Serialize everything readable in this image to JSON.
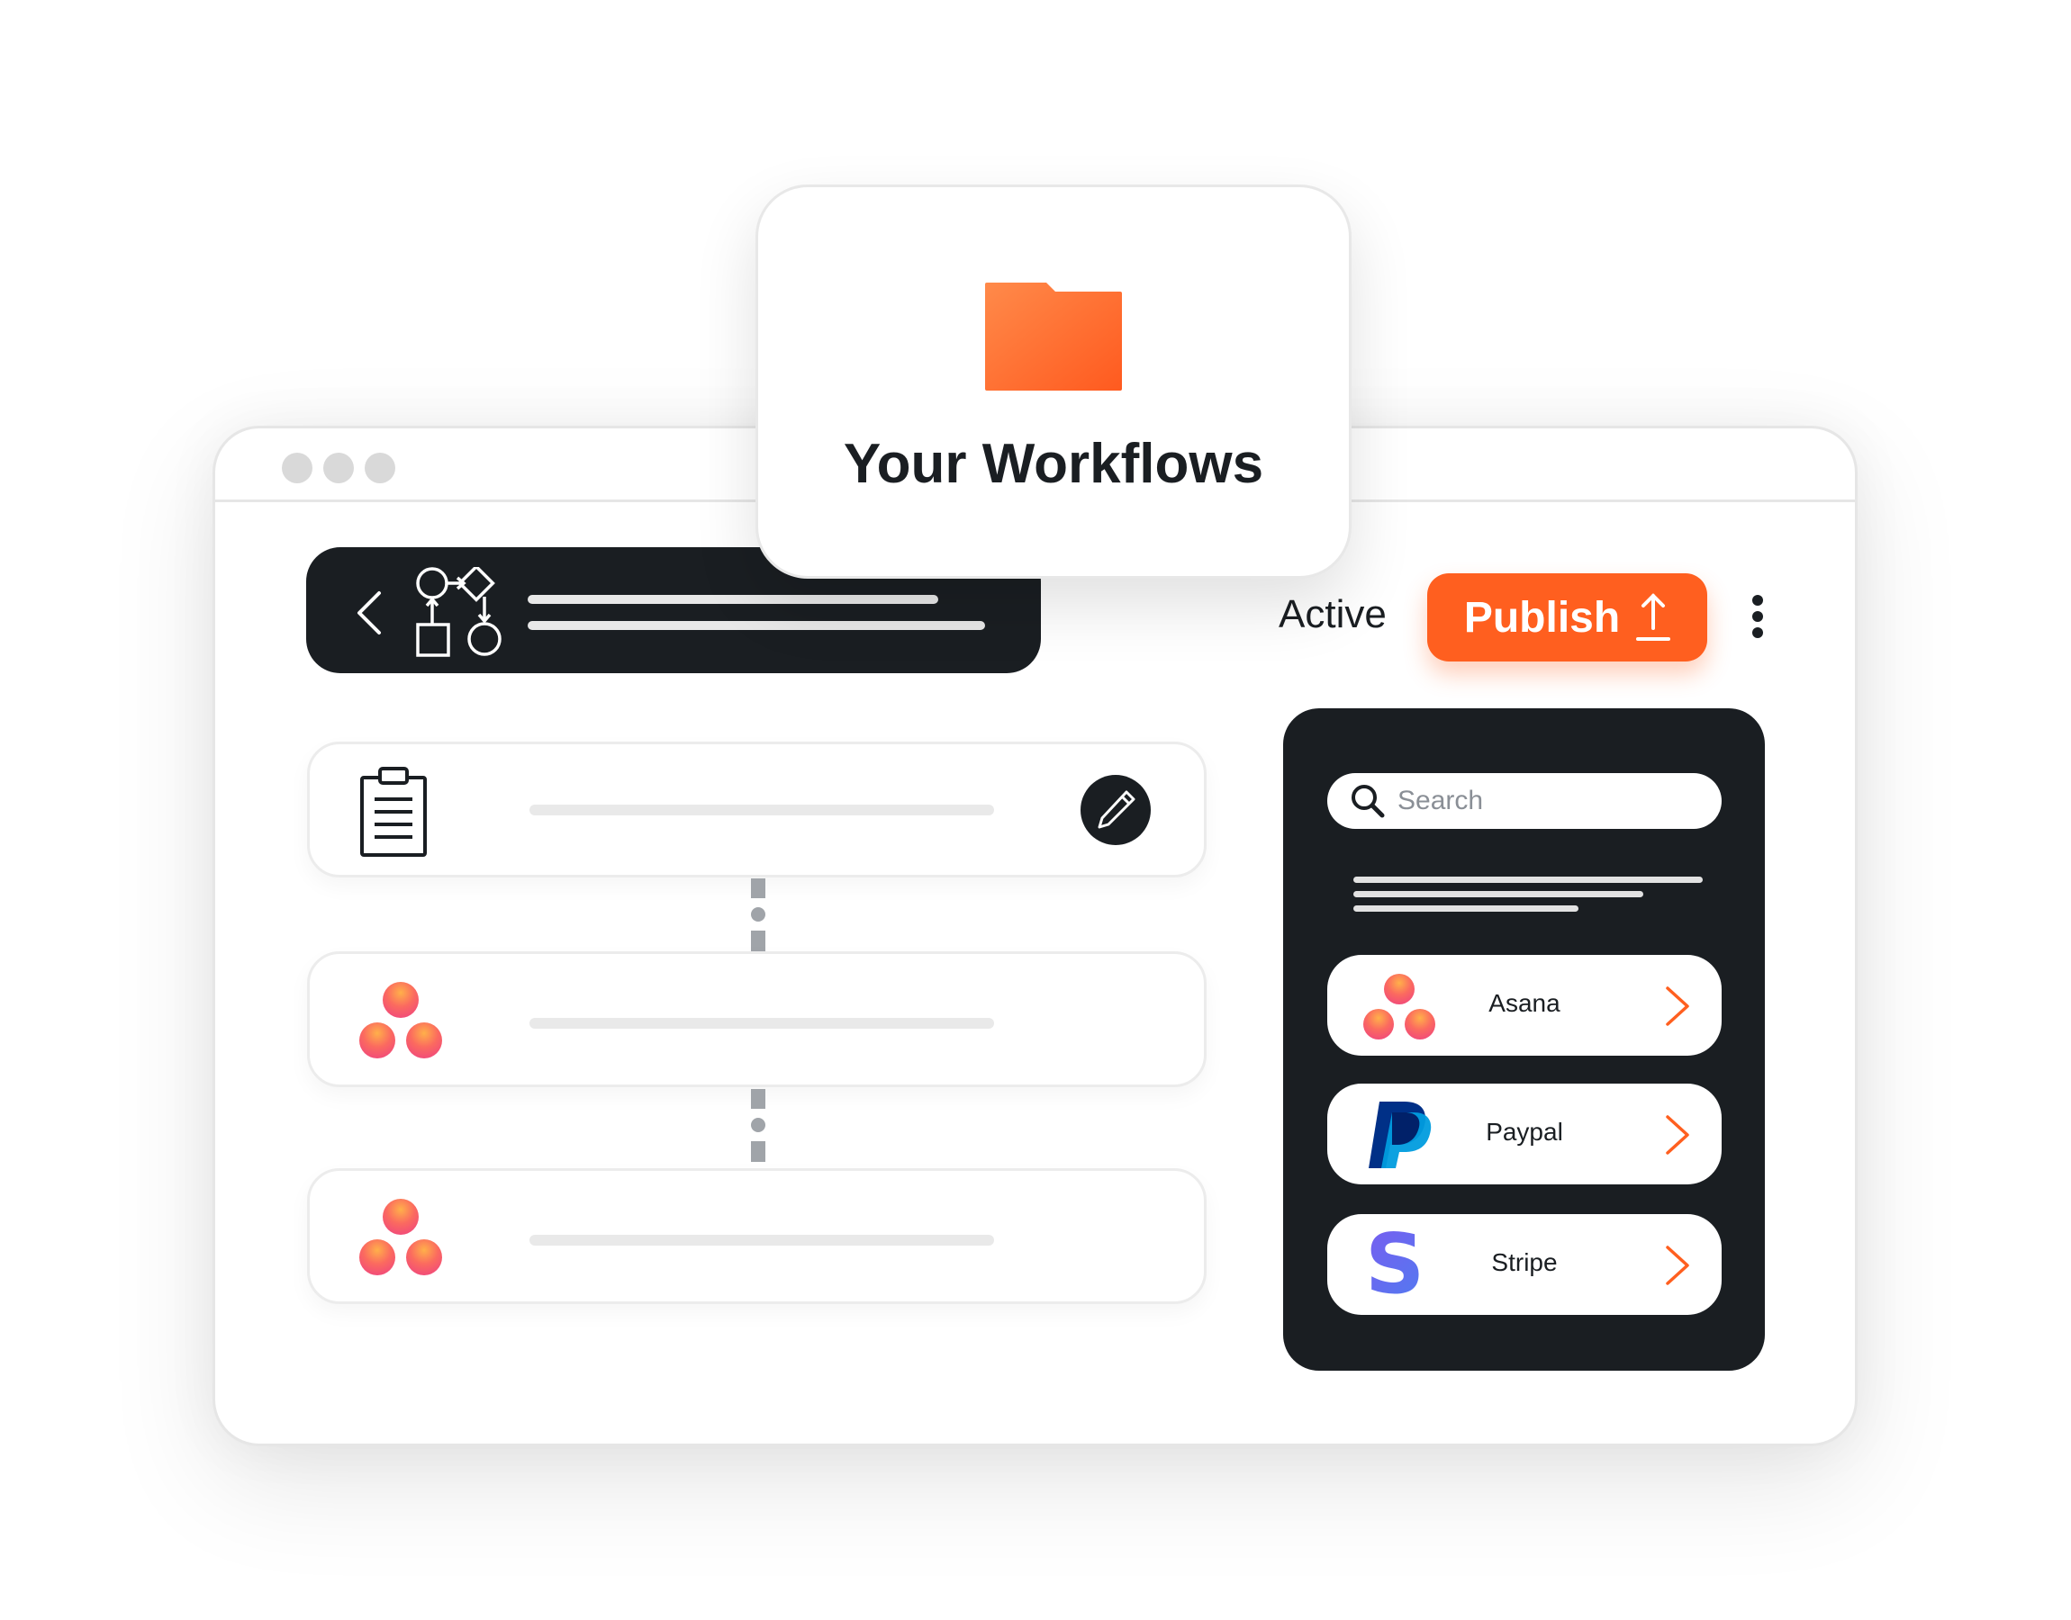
{
  "workflow_card": {
    "title": "Your Workflows",
    "icon": "folder-icon"
  },
  "header": {
    "status": "Active",
    "publish_label": "Publish",
    "icons": [
      "chevron-left-icon",
      "flowchart-icon",
      "upload-icon",
      "more-vertical-icon"
    ]
  },
  "steps": [
    {
      "icon": "clipboard-icon",
      "action_icon": "pencil-icon"
    },
    {
      "icon": "asana-logo-icon"
    },
    {
      "icon": "asana-logo-icon"
    }
  ],
  "panel": {
    "search_placeholder": "Search",
    "apps": [
      {
        "label": "Asana",
        "icon": "asana-logo-icon"
      },
      {
        "label": "Paypal",
        "icon": "paypal-logo-icon"
      },
      {
        "label": "Stripe",
        "icon": "stripe-logo-icon"
      }
    ]
  },
  "colors": {
    "accent": "#ff5f1f",
    "dark": "#1a1e22",
    "asana": "#f8596b",
    "paypal": "#0079c1",
    "stripe": "#635bff"
  }
}
